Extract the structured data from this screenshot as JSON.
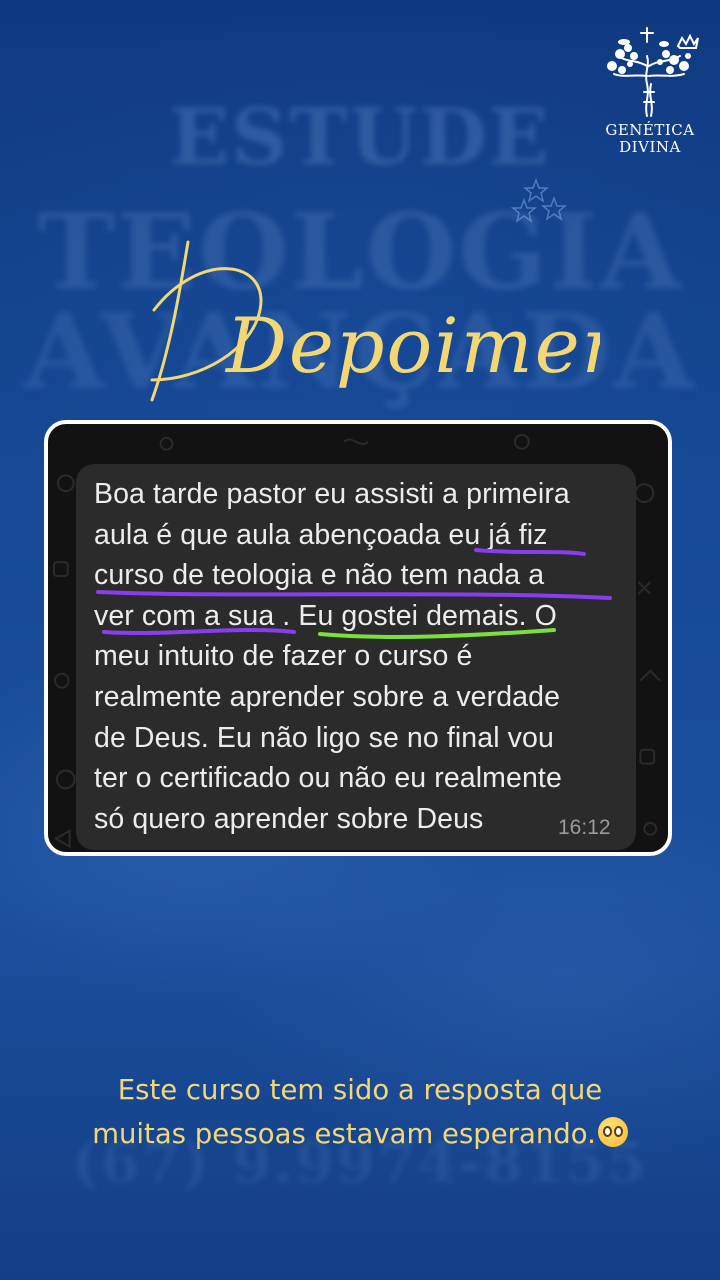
{
  "background": {
    "words": [
      "ESTUDE",
      "TEOLOGIA",
      "AVANÇADA",
      "(67) 9.9974-8155"
    ]
  },
  "logo": {
    "line1": "GENÉTICA",
    "line2": "DIVINA",
    "icon": "tree-cross-crown-dna-icon"
  },
  "title": "Depoimento",
  "chat": {
    "lines": [
      "Boa tarde pastor eu assisti a primeira",
      "aula é que aula abençoada eu já fiz",
      "curso de teologia e não tem nada a",
      "ver com a sua . Eu gostei demais. O",
      "meu intuito de fazer o curso é",
      "realmente aprender sobre a verdade",
      "de Deus. Eu não ligo se no final vou",
      "ter o certificado ou não eu realmente",
      "só quero aprender sobre Deus"
    ],
    "time": "16:12"
  },
  "caption": {
    "line1": "Este curso tem sido a resposta que",
    "line2": "muitas pessoas estavam esperando."
  },
  "colors": {
    "background": "#123f86",
    "title": "#f3d774",
    "caption": "#f3d774",
    "underline_purple": "#8a3cf0",
    "underline_green": "#7be03a"
  },
  "emoji": "pleading-face-emoji"
}
